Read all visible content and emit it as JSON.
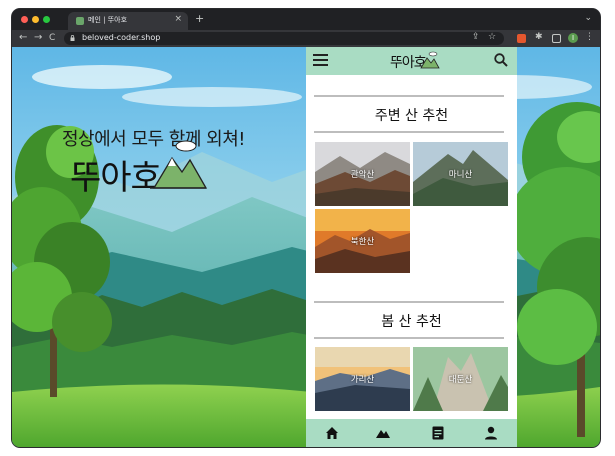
{
  "browser": {
    "tab_title": "메인 | 뚜아호",
    "tab_close": "×",
    "new_tab": "+",
    "tab_list": "⌄",
    "url": "beloved-coder.shop",
    "nav_back": "←",
    "nav_forward": "→",
    "nav_reload": "C",
    "share_glyph": "⇪",
    "bookmark_glyph": "☆",
    "puzzle_glyph": "✱",
    "profile_initial": "I"
  },
  "hero": {
    "tagline": "정상에서 모두 함께 외쳐!",
    "logo_text": "뚜아호"
  },
  "app": {
    "header_logo_text": "뚜아호",
    "sections": [
      {
        "title": "주변 산 추천",
        "cards": [
          {
            "label": "관악산"
          },
          {
            "label": "마니산"
          },
          {
            "label": "북한산"
          }
        ]
      },
      {
        "title": "봄 산 추천",
        "cards": [
          {
            "label": "가리산"
          },
          {
            "label": "대둔산"
          }
        ]
      }
    ]
  },
  "colors": {
    "app_header": "#a9dcc3",
    "browser_frame": "#202124"
  },
  "icons": {
    "header": [
      "menu-icon",
      "search-icon"
    ],
    "bottom_nav": [
      "home-icon",
      "mountain-icon",
      "document-icon",
      "user-icon"
    ]
  }
}
